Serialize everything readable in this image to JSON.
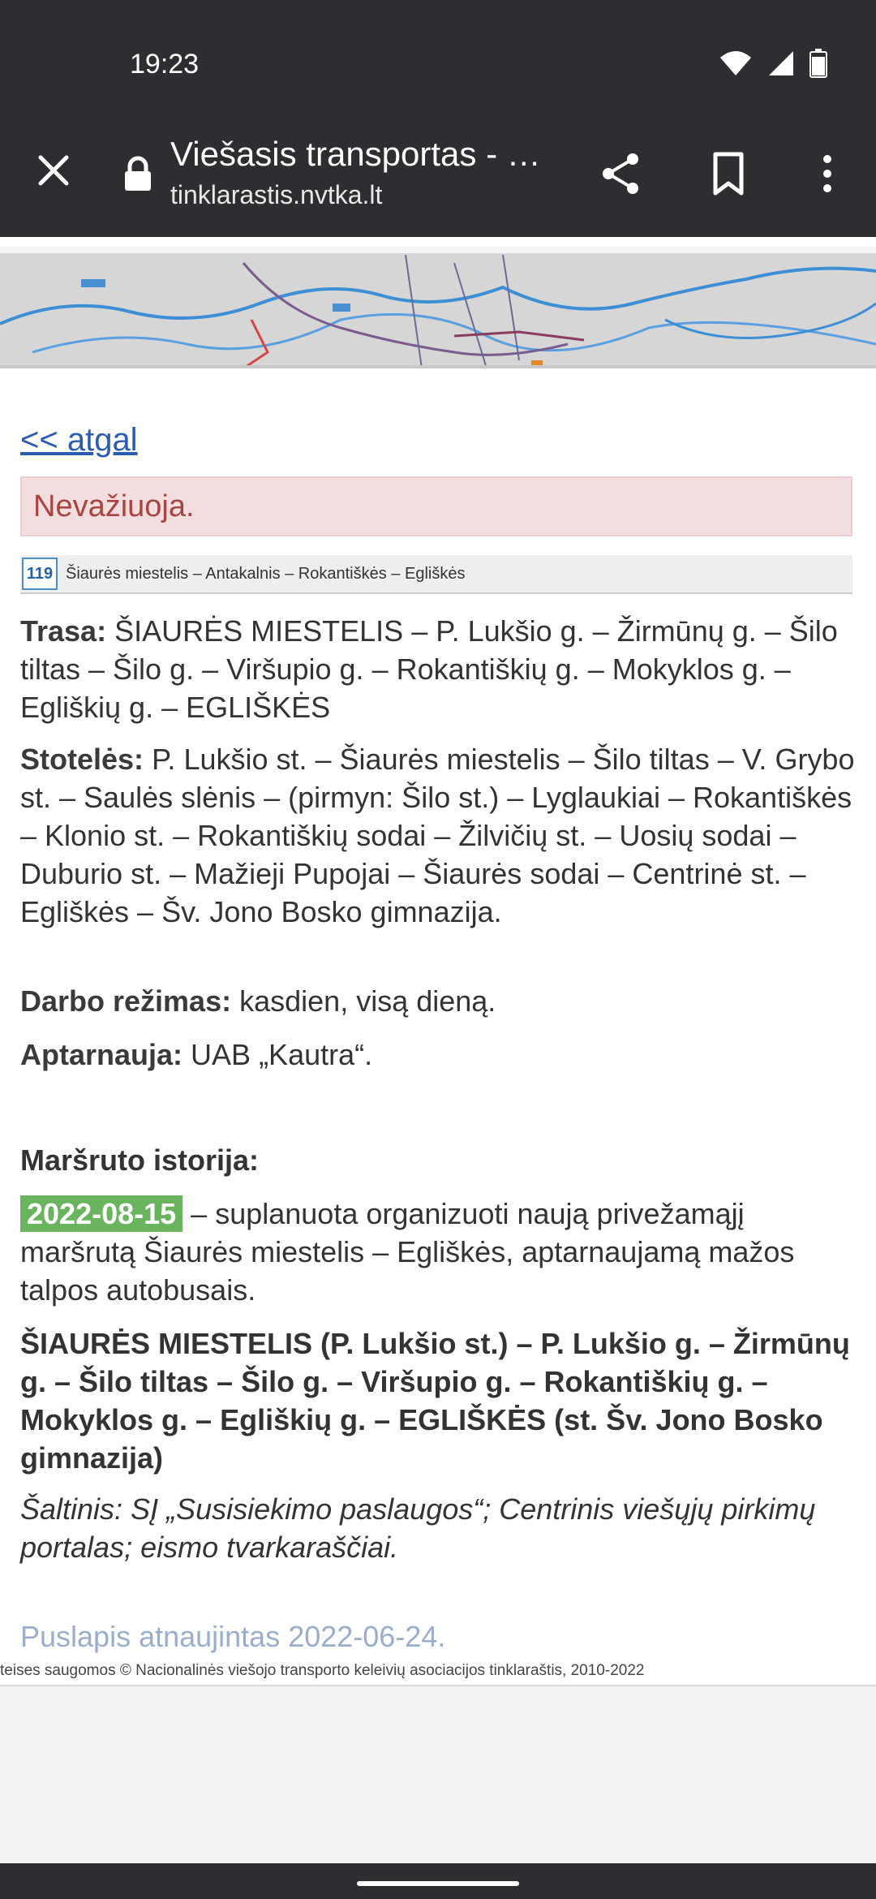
{
  "status_bar": {
    "time": "19:23"
  },
  "toolbar": {
    "title": "Viešasis transportas - …",
    "url": "tinklarastis.nvtka.lt"
  },
  "page": {
    "back_link": "<< atgal",
    "alert": "Nevažiuoja.",
    "route_number": "119",
    "route_name": "Šiaurės miestelis – Antakalnis – Rokantiškės – Egliškės",
    "trasa_label": "Trasa:",
    "trasa_text": "ŠIAURĖS MIESTELIS – P. Lukšio g. – Žirmūnų g. – Šilo tiltas – Šilo g. – Viršupio g. – Rokantiškių g. – Mokyklos g. – Egliškių g. – EGLIŠKĖS",
    "stoteles_label": "Stotelės:",
    "stoteles_text": "P. Lukšio st. – Šiaurės miestelis – Šilo tiltas – V. Grybo st. – Saulės slėnis – (pirmyn: Šilo st.) – Lyglaukiai – Rokantiškės – Klonio st. – Rokantiškių sodai – Žilvičių st. – Uosių sodai – Duburio st. – Mažieji Pupojai – Šiaurės sodai – Centrinė st. – Egliškės – Šv. Jono Bosko gimnazija.",
    "darbo_label": "Darbo režimas:",
    "darbo_text": "kasdien, visą dieną.",
    "aptarnauja_label": "Aptarnauja:",
    "aptarnauja_text": "UAB „Kautra“.",
    "history_title": "Maršruto istorija:",
    "history_date": "2022-08-15",
    "history_text": "– suplanuota organizuoti naują privežamąjį maršrutą Šiaurės miestelis – Egliškės, aptarnaujamą mažos talpos autobusais.",
    "history_route": "ŠIAURĖS MIESTELIS (P. Lukšio st.) – P. Lukšio g. – Žirmūnų g. – Šilo tiltas – Šilo g. – Viršupio g. – Rokantiškių g. – Mokyklos g. – Egliškių g. – EGLIŠKĖS (st. Šv. Jono Bosko gimnazija)",
    "source": "Šaltinis: SĮ „Susisiekimo paslaugos“; Centrinis viešųjų pirkimų portalas; eismo tvarkaraščiai.",
    "updated": "Puslapis atnaujintas 2022-06-24.",
    "footer": "teises saugomos © Nacionalinės viešojo transporto keleivių asociacijos tinklaraštis, 2010-2022"
  },
  "colors": {
    "toolbar_bg": "#2c2e31",
    "link": "#2a5db0",
    "alert_bg": "#f2dede",
    "alert_text": "#a94442",
    "date_badge": "#6bb45f",
    "updated_text": "#9aaecb"
  },
  "icons": [
    "wifi-icon",
    "signal-icon",
    "battery-icon",
    "close-icon",
    "lock-icon",
    "share-icon",
    "bookmark-icon",
    "more-vert-icon"
  ]
}
